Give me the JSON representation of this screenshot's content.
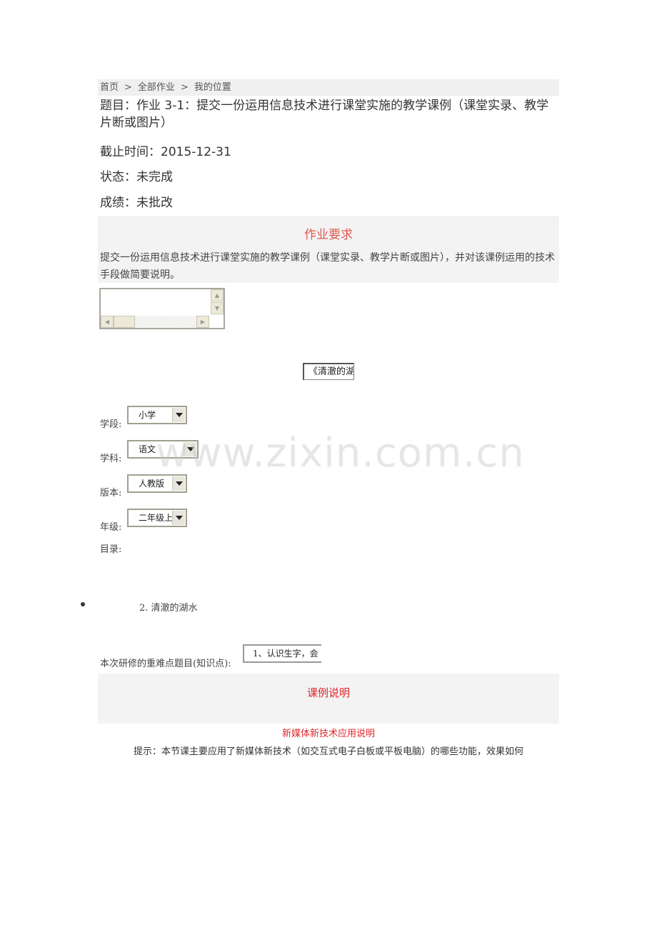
{
  "breadcrumb": {
    "home": "首页",
    "sep": ">",
    "all": "全部作业",
    "current": "我的位置"
  },
  "assignment": {
    "title": "题目：作业 3-1：提交一份运用信息技术进行课堂实施的教学课例（课堂实录、教学片断或图片）",
    "deadline": "截止时间：2015-12-31",
    "status": "状态：未完成",
    "score": "成绩：未批改"
  },
  "requirements": {
    "heading": "作业要求",
    "text": "提交一份运用信息技术进行课堂实施的教学课例（课堂实录、教学片断或图片），并对该课例运用的技术手段做简要说明。"
  },
  "course_field": {
    "value": "《清澈的湖"
  },
  "form": {
    "stage": {
      "label": "学段:",
      "value": "小学"
    },
    "subject": {
      "label": "学科:",
      "value": "语文"
    },
    "edition": {
      "label": "版本:",
      "value": "人教版"
    },
    "grade": {
      "label": "年级:",
      "value": "二年级上"
    },
    "catalog": {
      "label": "目录:"
    }
  },
  "lesson": {
    "item": "2. 清澈的湖水"
  },
  "keypoints": {
    "label": "本次研修的重难点题目(知识点):",
    "value": "1、认识生字，会"
  },
  "case_section": {
    "heading": "课例说明"
  },
  "media": {
    "heading": "新媒体新技术应用说明",
    "hint": "提示：本节课主要应用了新媒体新技术（如交互式电子白板或平板电脑）的哪些功能，效果如何"
  },
  "watermark": "www.zixin.com.cn"
}
